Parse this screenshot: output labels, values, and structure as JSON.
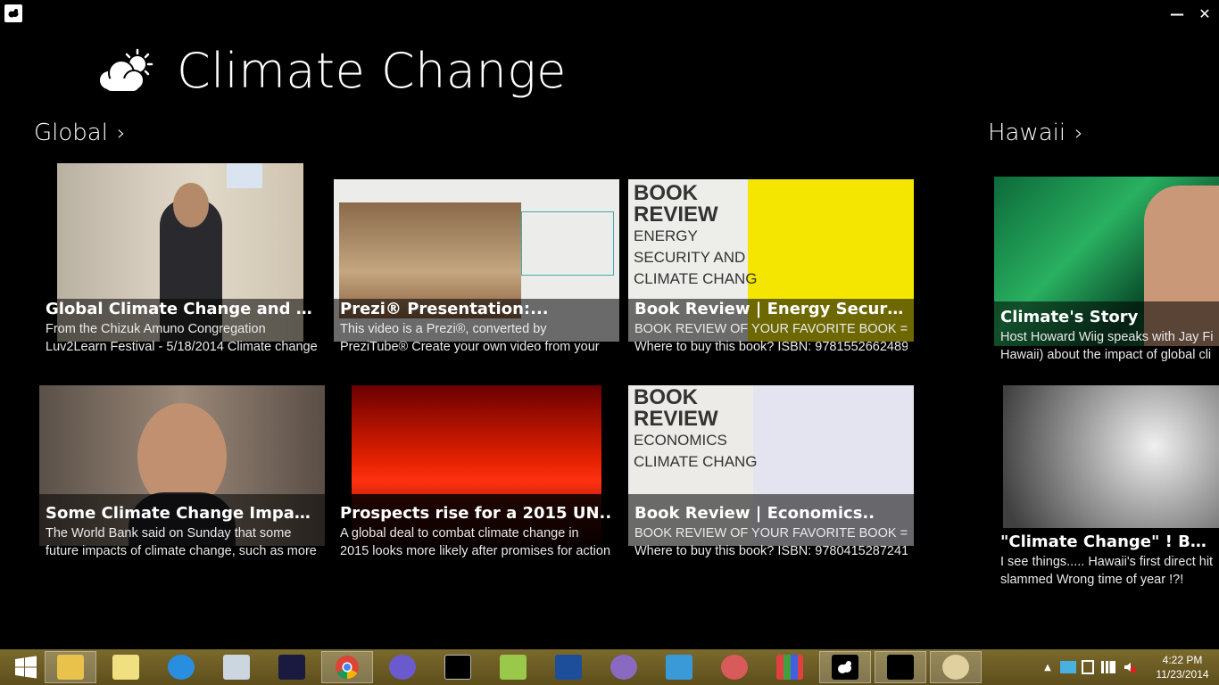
{
  "app": {
    "title": "Climate Change",
    "minimize_glyph": "—",
    "close_glyph": "✕"
  },
  "groups": [
    {
      "name": "Global",
      "chevron": "›"
    },
    {
      "name": "Hawaii",
      "chevron": "›"
    }
  ],
  "tiles": [
    {
      "title": "Global Climate Change and the...",
      "desc1": "From the Chizuk Amuno Congregation",
      "desc2": "Luv2Learn Festival - 5/18/2014 Climate change"
    },
    {
      "title": "Prezi® Presentation:...",
      "desc1": "This video is a Prezi®, converted by",
      "desc2": "PreziTube® Create your own video from your"
    },
    {
      "title": "Book Review | Energy Security...",
      "desc1": "BOOK REVIEW OF YOUR FAVORITE BOOK =---",
      "desc2": "Where to buy this book? ISBN: 9781552662489",
      "thumb_text": [
        "BOOK",
        "REVIEW",
        "ENERGY",
        "SECURITY AND",
        "CLIMATE CHANG"
      ]
    },
    {
      "title": "Some Climate Change Impacts...",
      "desc1": "The World Bank said on Sunday that some",
      "desc2": "future impacts of climate change, such as more"
    },
    {
      "title": "Prospects rise for a 2015 UN..",
      "desc1": "A global deal to combat climate change in",
      "desc2": "2015 looks more likely after promises for action"
    },
    {
      "title": "Book Review | Economics..",
      "desc1": "BOOK REVIEW OF YOUR FAVORITE BOOK =---",
      "desc2": "Where to buy this book? ISBN: 9780415287241",
      "thumb_text": [
        "BOOK",
        "REVIEW",
        "ECONOMICS",
        "CLIMATE CHANG"
      ]
    },
    {
      "title": "Climate's Story",
      "desc1": "Host Howard Wiig speaks with Jay Fid",
      "desc2": "Hawaii) about the impact of global cli"
    },
    {
      "title": "\"Climate Change\" ! Bermuc",
      "desc1": "I see things..... Hawaii's first direct hit E",
      "desc2": "slammed Wrong time of year !?!"
    }
  ],
  "taskbar": {
    "items": [
      "start-button",
      "file-explorer",
      "sticky-notes",
      "windows-live",
      "calculator",
      "kindle",
      "chrome",
      "cat-app",
      "command-prompt",
      "notepad-app",
      "u-app",
      "pidgin",
      "media-app",
      "scissors-app",
      "apps-grid",
      "climate-change-app",
      "black-window",
      "paint"
    ],
    "time": "4:22 PM",
    "date": "11/23/2014"
  }
}
